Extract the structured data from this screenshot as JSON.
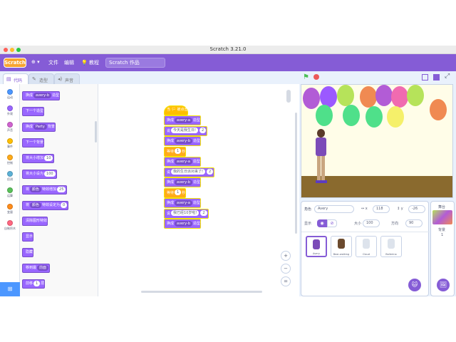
{
  "window": {
    "title": "Scratch 3.21.0"
  },
  "menubar": {
    "logo": "Scratch",
    "language": "⊕ ▾",
    "file": "文件",
    "edit": "编辑",
    "tutorials": "教程",
    "project_name": "Scratch 作品"
  },
  "tabs": {
    "code": "代码",
    "costumes": "造型",
    "sounds": "声音"
  },
  "categories": [
    {
      "label": "运动",
      "color": "#4c97ff"
    },
    {
      "label": "外观",
      "color": "#9966ff"
    },
    {
      "label": "声音",
      "color": "#cf63cf"
    },
    {
      "label": "事件",
      "color": "#ffbf00"
    },
    {
      "label": "控制",
      "color": "#ffab19"
    },
    {
      "label": "侦测",
      "color": "#5cb1d6"
    },
    {
      "label": "运算",
      "color": "#59c059"
    },
    {
      "label": "变量",
      "color": "#ff8c1a"
    },
    {
      "label": "自制积木",
      "color": "#ff6680"
    }
  ],
  "palette": [
    {
      "pre": "换成",
      "dd": "avery-b",
      "post": "造型"
    },
    {
      "pre": "下一个造型",
      "dd": "",
      "post": ""
    },
    {
      "pre": "换成",
      "dd": "Party",
      "post": "背景"
    },
    {
      "pre": "下一个背景",
      "dd": "",
      "post": ""
    },
    {
      "pre": "将大小增加",
      "in": "10",
      "post": ""
    },
    {
      "pre": "将大小设为",
      "in": "100",
      "post": ""
    },
    {
      "pre": "将",
      "dd": "颜色",
      "post": "特效增加",
      "in2": "25"
    },
    {
      "pre": "将",
      "dd": "颜色",
      "post": "特效设定为",
      "in2": "0"
    },
    {
      "pre": "清除图形特效",
      "dd": "",
      "post": ""
    },
    {
      "pre": "显示",
      "dd": "",
      "post": ""
    },
    {
      "pre": "隐藏",
      "dd": "",
      "post": ""
    },
    {
      "pre": "移到最",
      "dd": "前面",
      "post": ""
    },
    {
      "pre": "前移",
      "in": "1",
      "post": "层"
    }
  ],
  "script": {
    "hat": "当 🏳 被点击",
    "blocks": [
      {
        "kind": "looks",
        "pre": "换成",
        "dd": "avery-a",
        "post": "造型"
      },
      {
        "kind": "looks",
        "pre": "说",
        "in": "今天是我生日!",
        "post": "",
        "in2": "2"
      },
      {
        "kind": "looks",
        "pre": "换成",
        "dd": "avery-b",
        "post": "造型"
      },
      {
        "kind": "ctrl",
        "pre": "等待",
        "in": "1",
        "post": "秒"
      },
      {
        "kind": "looks",
        "pre": "换成",
        "dd": "avery-a",
        "post": "造型"
      },
      {
        "kind": "looks",
        "pre": "说",
        "in": "我的生日派对来了!",
        "post": "",
        "in2": "2"
      },
      {
        "kind": "looks",
        "pre": "换成",
        "dd": "avery-b",
        "post": "造型"
      },
      {
        "kind": "ctrl",
        "pre": "等待",
        "in": "1",
        "post": "秒"
      },
      {
        "kind": "looks",
        "pre": "换成",
        "dd": "avery-a",
        "post": "造型"
      },
      {
        "kind": "looks",
        "pre": "说",
        "in": "我已经10岁啦!",
        "post": "",
        "in2": "2"
      },
      {
        "kind": "looks",
        "pre": "换成",
        "dd": "avery-b",
        "post": "造型"
      }
    ]
  },
  "zoom": {
    "in": "+",
    "out": "−",
    "reset": "="
  },
  "sprite_info": {
    "sprite_label": "角色",
    "sprite_name": "Avery",
    "x_label": "↔ x",
    "x_value": "118",
    "y_label": "↕ y",
    "y_value": "-26",
    "show_label": "显示",
    "size_label": "大小",
    "size_value": "100",
    "direction_label": "方向",
    "direction_value": "90"
  },
  "sprites": [
    {
      "name": "Avery"
    },
    {
      "name": "Bear-walking"
    },
    {
      "name": "Cloud"
    },
    {
      "name": "Ballerina"
    }
  ],
  "stage_panel": {
    "label": "舞台",
    "backdrops_label": "背景",
    "backdrops_count": "1"
  }
}
